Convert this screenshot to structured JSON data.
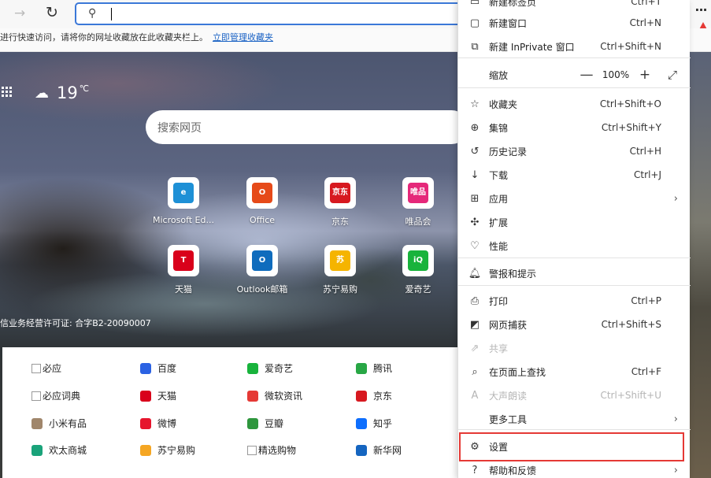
{
  "toolbar": {
    "forward_icon": "→",
    "refresh_icon": "↻",
    "more_icon": "···"
  },
  "favbar": {
    "text": "进行快速访问，请将你的网址收藏放在此收藏夹栏上。",
    "link": "立即管理收藏夹"
  },
  "weather": {
    "temp": "19",
    "unit": "℃"
  },
  "search": {
    "placeholder": "搜索网页"
  },
  "tiles": [
    {
      "label": "Microsoft Ed...",
      "icon": "edge-icon",
      "color": "#1e90d6",
      "glyph": "e"
    },
    {
      "label": "Office",
      "icon": "office-icon",
      "color": "#e64a19",
      "glyph": "O"
    },
    {
      "label": "京东",
      "icon": "jd-icon",
      "color": "#d71920",
      "glyph": "京东"
    },
    {
      "label": "唯品会",
      "icon": "vip-icon",
      "color": "#e5287a",
      "glyph": "唯品会"
    },
    {
      "label": "天猫",
      "icon": "tmall-icon",
      "color": "#d9001b",
      "glyph": "T"
    },
    {
      "label": "Outlook邮箱",
      "icon": "outlook-icon",
      "color": "#0f6cbd",
      "glyph": "O"
    },
    {
      "label": "苏宁易购",
      "icon": "suning-icon",
      "color": "#f5b400",
      "glyph": "苏"
    },
    {
      "label": "爱奇艺",
      "icon": "iqiyi-icon",
      "color": "#18b33c",
      "glyph": "iQ"
    }
  ],
  "license": "信业务经营许可证: 合字B2-20090007",
  "links": [
    [
      {
        "text": "必应",
        "broken": true
      },
      {
        "text": "百度",
        "icon": "baidu-icon",
        "color": "#2b62e3"
      },
      {
        "text": "爱奇艺",
        "icon": "iqiyi-icon",
        "color": "#18b33c"
      },
      {
        "text": "腾讯",
        "icon": "tencent-icon",
        "color": "#28a745"
      }
    ],
    [
      {
        "text": "必应词典",
        "broken": true
      },
      {
        "text": "天猫",
        "icon": "tmall-icon",
        "color": "#d9001b"
      },
      {
        "text": "微软资讯",
        "icon": "msn-icon",
        "color": "#e53935"
      },
      {
        "text": "京东",
        "icon": "jd-icon",
        "color": "#d71920"
      }
    ],
    [
      {
        "text": "小米有品",
        "icon": "youpin-icon",
        "color": "#a0866b"
      },
      {
        "text": "微博",
        "icon": "weibo-icon",
        "color": "#e6162d"
      },
      {
        "text": "豆瓣",
        "icon": "douban-icon",
        "color": "#2e963d"
      },
      {
        "text": "知乎",
        "icon": "zhihu-icon",
        "color": "#0d6efd"
      }
    ],
    [
      {
        "text": "欢太商城",
        "icon": "heytap-icon",
        "color": "#1aa37a"
      },
      {
        "text": "苏宁易购",
        "icon": "suning-icon",
        "color": "#f5a623"
      },
      {
        "text": "精选购物",
        "broken": true
      },
      {
        "text": "新华网",
        "icon": "xinhua-icon",
        "color": "#1565c0"
      }
    ]
  ],
  "menu": {
    "items": [
      {
        "label": "新建标签页",
        "shortcut": "Ctrl+T",
        "icon": "new-tab-icon",
        "glyph": "▭"
      },
      {
        "label": "新建窗口",
        "shortcut": "Ctrl+N",
        "icon": "new-window-icon",
        "glyph": "▢"
      },
      {
        "label": "新建 InPrivate 窗口",
        "shortcut": "Ctrl+Shift+N",
        "icon": "inprivate-icon",
        "glyph": "⧉"
      },
      {
        "label": "缩放",
        "zoom": "100%",
        "icon": "zoom-icon",
        "glyph": ""
      },
      {
        "label": "收藏夹",
        "shortcut": "Ctrl+Shift+O",
        "icon": "favorites-icon",
        "glyph": "☆"
      },
      {
        "label": "集锦",
        "shortcut": "Ctrl+Shift+Y",
        "icon": "collections-icon",
        "glyph": "⊕"
      },
      {
        "label": "历史记录",
        "shortcut": "Ctrl+H",
        "icon": "history-icon",
        "glyph": "↺"
      },
      {
        "label": "下载",
        "shortcut": "Ctrl+J",
        "icon": "download-icon",
        "glyph": "↓"
      },
      {
        "label": "应用",
        "chevron": "›",
        "icon": "apps-icon",
        "glyph": "⊞"
      },
      {
        "label": "扩展",
        "icon": "extensions-icon",
        "glyph": "✣"
      },
      {
        "label": "性能",
        "icon": "performance-icon",
        "glyph": "♡"
      },
      {
        "label": "警报和提示",
        "icon": "bell-icon",
        "glyph": "🔔︎"
      },
      {
        "label": "打印",
        "shortcut": "Ctrl+P",
        "icon": "print-icon",
        "glyph": "⎙"
      },
      {
        "label": "网页捕获",
        "shortcut": "Ctrl+Shift+S",
        "icon": "capture-icon",
        "glyph": "◩"
      },
      {
        "label": "共享",
        "disabled": true,
        "icon": "share-icon",
        "glyph": "⇗"
      },
      {
        "label": "在页面上查找",
        "shortcut": "Ctrl+F",
        "icon": "find-icon",
        "glyph": "⌕"
      },
      {
        "label": "大声朗读",
        "shortcut": "Ctrl+Shift+U",
        "disabled": true,
        "icon": "read-aloud-icon",
        "glyph": "A"
      },
      {
        "label": "更多工具",
        "chevron": "›",
        "icon": "more-tools-icon",
        "glyph": ""
      },
      {
        "label": "设置",
        "icon": "settings-icon",
        "glyph": "⚙"
      },
      {
        "label": "帮助和反馈",
        "chevron": "›",
        "icon": "help-icon",
        "glyph": "?"
      }
    ],
    "zoom_minus": "—",
    "zoom_plus": "+",
    "fullscreen": "⤢"
  },
  "colors": {
    "accent": "#3b78d8",
    "highlight": "#e53935"
  }
}
